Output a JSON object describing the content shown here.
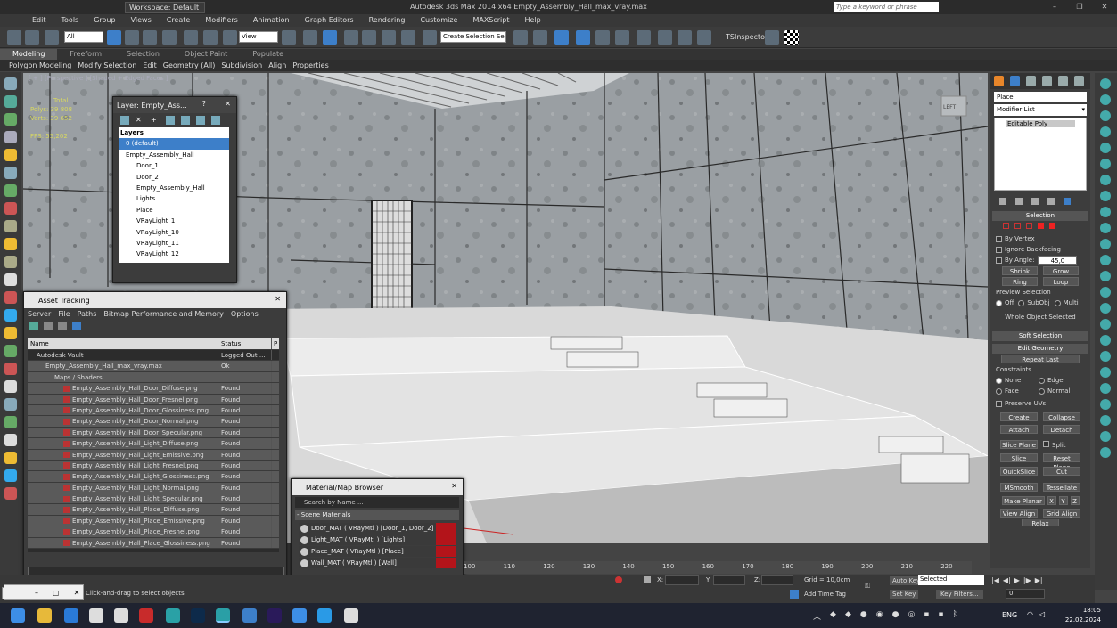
{
  "window": {
    "workspace": "Workspace: Default",
    "title": "Autodesk 3ds Max  2014 x64     Empty_Assembly_Hall_max_vray.max",
    "search_placeholder": "Type a keyword or phrase"
  },
  "menu": [
    "Edit",
    "Tools",
    "Group",
    "Views",
    "Create",
    "Modifiers",
    "Animation",
    "Graph Editors",
    "Rendering",
    "Customize",
    "MAXScript",
    "Help"
  ],
  "toolbar": {
    "filter": "All",
    "ref_coord": "View",
    "selection_set": "Create Selection Se",
    "tsinspector": "TSInspector"
  },
  "ribbon": {
    "tabs": [
      "Modeling",
      "Freeform",
      "Selection",
      "Object Paint",
      "Populate"
    ],
    "sub": [
      "Polygon Modeling",
      "Modify Selection",
      "Edit",
      "Geometry (All)",
      "Subdivision",
      "Align",
      "Properties"
    ]
  },
  "viewport": {
    "label": "[ + ] [Perspective ] [Shaded + Edged Faces ]",
    "stats": {
      "total_label": "Total",
      "polys_label": "Polys:",
      "polys": "39 808",
      "verts_label": "Verts:",
      "verts": "39 652",
      "fps_label": "FPS:",
      "fps": "55,202"
    }
  },
  "layer_panel": {
    "title": "Layer: Empty_Ass...",
    "help": "?",
    "header": "Layers",
    "items": [
      {
        "label": "0 (default)",
        "level": 0,
        "selected": true
      },
      {
        "label": "Empty_Assembly_Hall",
        "level": 0
      },
      {
        "label": "Door_1",
        "level": 1
      },
      {
        "label": "Door_2",
        "level": 1
      },
      {
        "label": "Empty_Assembly_Hall",
        "level": 1
      },
      {
        "label": "Lights",
        "level": 1
      },
      {
        "label": "Place",
        "level": 1
      },
      {
        "label": "VRayLight_1",
        "level": 1
      },
      {
        "label": "VRayLight_10",
        "level": 1
      },
      {
        "label": "VRayLight_11",
        "level": 1
      },
      {
        "label": "VRayLight_12",
        "level": 1
      }
    ]
  },
  "asset_tracking": {
    "title": "Asset Tracking",
    "menu": [
      "Server",
      "File",
      "Paths",
      "Bitmap Performance and Memory",
      "Options"
    ],
    "columns": {
      "name": "Name",
      "status": "Status",
      "p": "P"
    },
    "rows": [
      {
        "name": "Autodesk Vault",
        "status": "Logged Out ...",
        "indent": 1
      },
      {
        "name": "Empty_Assembly_Hall_max_vray.max",
        "status": "Ok",
        "indent": 2
      },
      {
        "name": "Maps / Shaders",
        "status": "",
        "indent": 3
      },
      {
        "name": "Empty_Assembly_Hall_Door_Diffuse.png",
        "status": "Found",
        "indent": 4
      },
      {
        "name": "Empty_Assembly_Hall_Door_Fresnel.png",
        "status": "Found",
        "indent": 4
      },
      {
        "name": "Empty_Assembly_Hall_Door_Glossiness.png",
        "status": "Found",
        "indent": 4
      },
      {
        "name": "Empty_Assembly_Hall_Door_Normal.png",
        "status": "Found",
        "indent": 4
      },
      {
        "name": "Empty_Assembly_Hall_Door_Specular.png",
        "status": "Found",
        "indent": 4
      },
      {
        "name": "Empty_Assembly_Hall_Light_Diffuse.png",
        "status": "Found",
        "indent": 4
      },
      {
        "name": "Empty_Assembly_Hall_Light_Emissive.png",
        "status": "Found",
        "indent": 4
      },
      {
        "name": "Empty_Assembly_Hall_Light_Fresnel.png",
        "status": "Found",
        "indent": 4
      },
      {
        "name": "Empty_Assembly_Hall_Light_Glossiness.png",
        "status": "Found",
        "indent": 4
      },
      {
        "name": "Empty_Assembly_Hall_Light_Normal.png",
        "status": "Found",
        "indent": 4
      },
      {
        "name": "Empty_Assembly_Hall_Light_Specular.png",
        "status": "Found",
        "indent": 4
      },
      {
        "name": "Empty_Assembly_Hall_Place_Diffuse.png",
        "status": "Found",
        "indent": 4
      },
      {
        "name": "Empty_Assembly_Hall_Place_Emissive.png",
        "status": "Found",
        "indent": 4
      },
      {
        "name": "Empty_Assembly_Hall_Place_Fresnel.png",
        "status": "Found",
        "indent": 4
      },
      {
        "name": "Empty_Assembly_Hall_Place_Glossiness.png",
        "status": "Found",
        "indent": 4
      }
    ]
  },
  "material_browser": {
    "title": "Material/Map Browser",
    "search": "Search by Name ...",
    "group": "- Scene Materials",
    "items": [
      "Door_MAT  ( VRayMtl ) [Door_1, Door_2]",
      "Light_MAT  ( VRayMtl ) [Lights]",
      "Place_MAT  ( VRayMtl ) [Place]",
      "Wall_MAT  ( VRayMtl ) [Wall]"
    ]
  },
  "command_panel": {
    "name_field": "Place",
    "modifier_list": "Modifier List",
    "stack_item": "Editable Poly",
    "selection": {
      "header": "Selection",
      "by_vertex": "By Vertex",
      "ignore_backfacing": "Ignore Backfacing",
      "by_angle": "By Angle:",
      "angle": "45,0",
      "shrink": "Shrink",
      "grow": "Grow",
      "ring": "Ring",
      "loop": "Loop",
      "preview": "Preview Selection",
      "off": "Off",
      "subobj": "SubObj",
      "multi": "Multi",
      "whole": "Whole Object Selected"
    },
    "soft_selection": "Soft Selection",
    "edit_geometry": {
      "header": "Edit Geometry",
      "repeat_last": "Repeat Last",
      "constraints": "Constraints",
      "none": "None",
      "edge": "Edge",
      "face": "Face",
      "normal": "Normal",
      "preserve_uvs": "Preserve UVs",
      "create": "Create",
      "collapse": "Collapse",
      "attach": "Attach",
      "detach": "Detach",
      "slice_plane": "Slice Plane",
      "split": "Split",
      "slice": "Slice",
      "reset_plane": "Reset Plane",
      "quickslice": "QuickSlice",
      "cut": "Cut",
      "msmooth": "MSmooth",
      "tessellate": "Tessellate",
      "make_planar": "Make Planar",
      "x": "X",
      "y": "Y",
      "z": "Z",
      "view_align": "View Align",
      "grid_align": "Grid Align",
      "relax": "Relax"
    }
  },
  "timeline": {
    "ticks": [
      "100",
      "110",
      "120",
      "130",
      "140",
      "150",
      "160",
      "170",
      "180",
      "190",
      "200",
      "210",
      "220"
    ]
  },
  "status": {
    "prompt": "Click-and-drag to select objects",
    "x_label": "X:",
    "y_label": "Y:",
    "z_label": "Z:",
    "grid": "Grid = 10,0cm",
    "add_time_tag": "Add Time Tag",
    "auto_key": "Auto Key",
    "selected": "Selected",
    "set_key": "Set Key",
    "key_filters": "Key Filters...",
    "frame": "0"
  },
  "taskbar": {
    "lang": "ENG",
    "time": "18:05",
    "date": "22.02.2024"
  }
}
